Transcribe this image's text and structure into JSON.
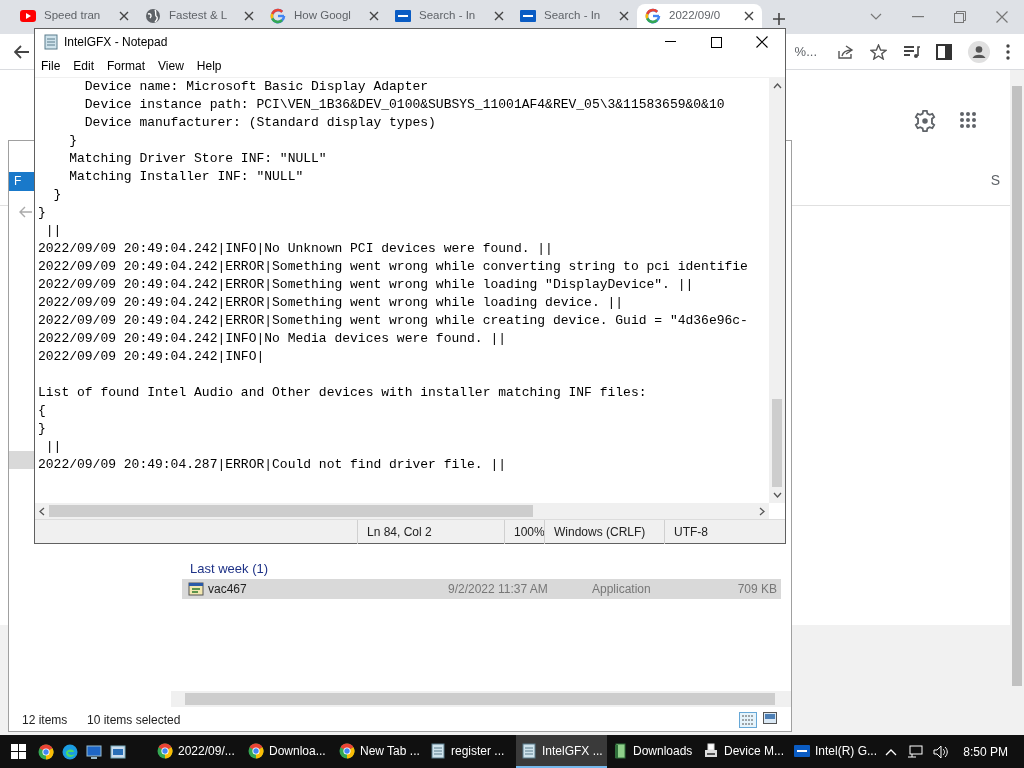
{
  "browser": {
    "tabs": [
      {
        "label": "Speed tran",
        "kind": "video",
        "selected": false
      },
      {
        "label": "Fastest & L",
        "kind": "globe",
        "selected": false
      },
      {
        "label": "How Googl",
        "kind": "g",
        "selected": false
      },
      {
        "label": "Search - In",
        "kind": "chip",
        "selected": false
      },
      {
        "label": "Search - In",
        "kind": "chip",
        "selected": false
      },
      {
        "label": "2022/09/0",
        "kind": "g",
        "selected": true
      }
    ],
    "zoom_text": "%...",
    "page_text": "S"
  },
  "explorer": {
    "ribbon_tab": "F",
    "group_header": "Last week (1)",
    "files": [
      {
        "name": "vac467",
        "date": "9/2/2022 11:37 AM",
        "type": "Application",
        "size": "709 KB",
        "selected": true
      }
    ],
    "item_count": "12 items",
    "selection_count": "10 items selected"
  },
  "notepad": {
    "title": "IntelGFX - Notepad",
    "menu": [
      "File",
      "Edit",
      "Format",
      "View",
      "Help"
    ],
    "lines": [
      {
        "text": "      Device name: Microsoft Basic Display Adapter"
      },
      {
        "text": "      Device instance path: PCI\\VEN_1B36&DEV_0100&SUBSYS_11001AF4&REV_05\\3&11583659&0&10"
      },
      {
        "text": "      Device manufacturer: (Standard display types)"
      },
      {
        "text": "    }"
      },
      {
        "text": "    Matching Driver Store INF: \"NULL\""
      },
      {
        "text": "    Matching Installer INF: \"NULL\""
      },
      {
        "text": "  }"
      },
      {
        "text": "}"
      },
      {
        "text": " ||"
      },
      {
        "text": "2022/09/09 20:49:04.242|INFO|No Unknown PCI devices were found. ||"
      },
      {
        "text": "2022/09/09 20:49:04.242|ERROR|Something went wrong while converting string to pci identifie"
      },
      {
        "text": "2022/09/09 20:49:04.242|ERROR|Something went wrong while loading \"DisplayDevice\". ||"
      },
      {
        "text": "2022/09/09 20:49:04.242|ERROR|Something went wrong while loading device. ||"
      },
      {
        "text": "2022/09/09 20:49:04.242|ERROR|Something went wrong while creating device. Guid = \"4d36e96c-"
      },
      {
        "text": "2022/09/09 20:49:04.242|INFO|No Media devices were found. ||"
      },
      {
        "text": "2022/09/09 20:49:04.242|INFO|"
      },
      {
        "kind": "blank"
      },
      {
        "text": "List of found Intel Audio and Other devices with installer matching INF files:"
      },
      {
        "text": "{"
      },
      {
        "text": "}"
      },
      {
        "text": " ||"
      },
      {
        "text": "2022/09/09 20:49:04.287|ERROR|Could not find driver file. ||"
      }
    ],
    "status": [
      "Ln 84, Col 2",
      "100%",
      "Windows (CRLF)",
      "UTF-8"
    ]
  },
  "taskbar": {
    "items": [
      {
        "label": "2022/09/...",
        "kind": "chrome",
        "selected": false
      },
      {
        "label": "Downloa...",
        "kind": "chrome",
        "selected": false
      },
      {
        "label": "New Tab ...",
        "kind": "chrome",
        "selected": false
      },
      {
        "label": "register ...",
        "kind": "notepad",
        "selected": false
      },
      {
        "label": "IntelGFX ...",
        "kind": "notepad",
        "selected": true
      },
      {
        "label": "Downloads",
        "kind": "folder",
        "selected": false
      },
      {
        "label": "Device M...",
        "kind": "device",
        "selected": false
      },
      {
        "label": "Intel(R) G...",
        "kind": "chip",
        "selected": false
      }
    ],
    "clock": "8:50 PM"
  }
}
